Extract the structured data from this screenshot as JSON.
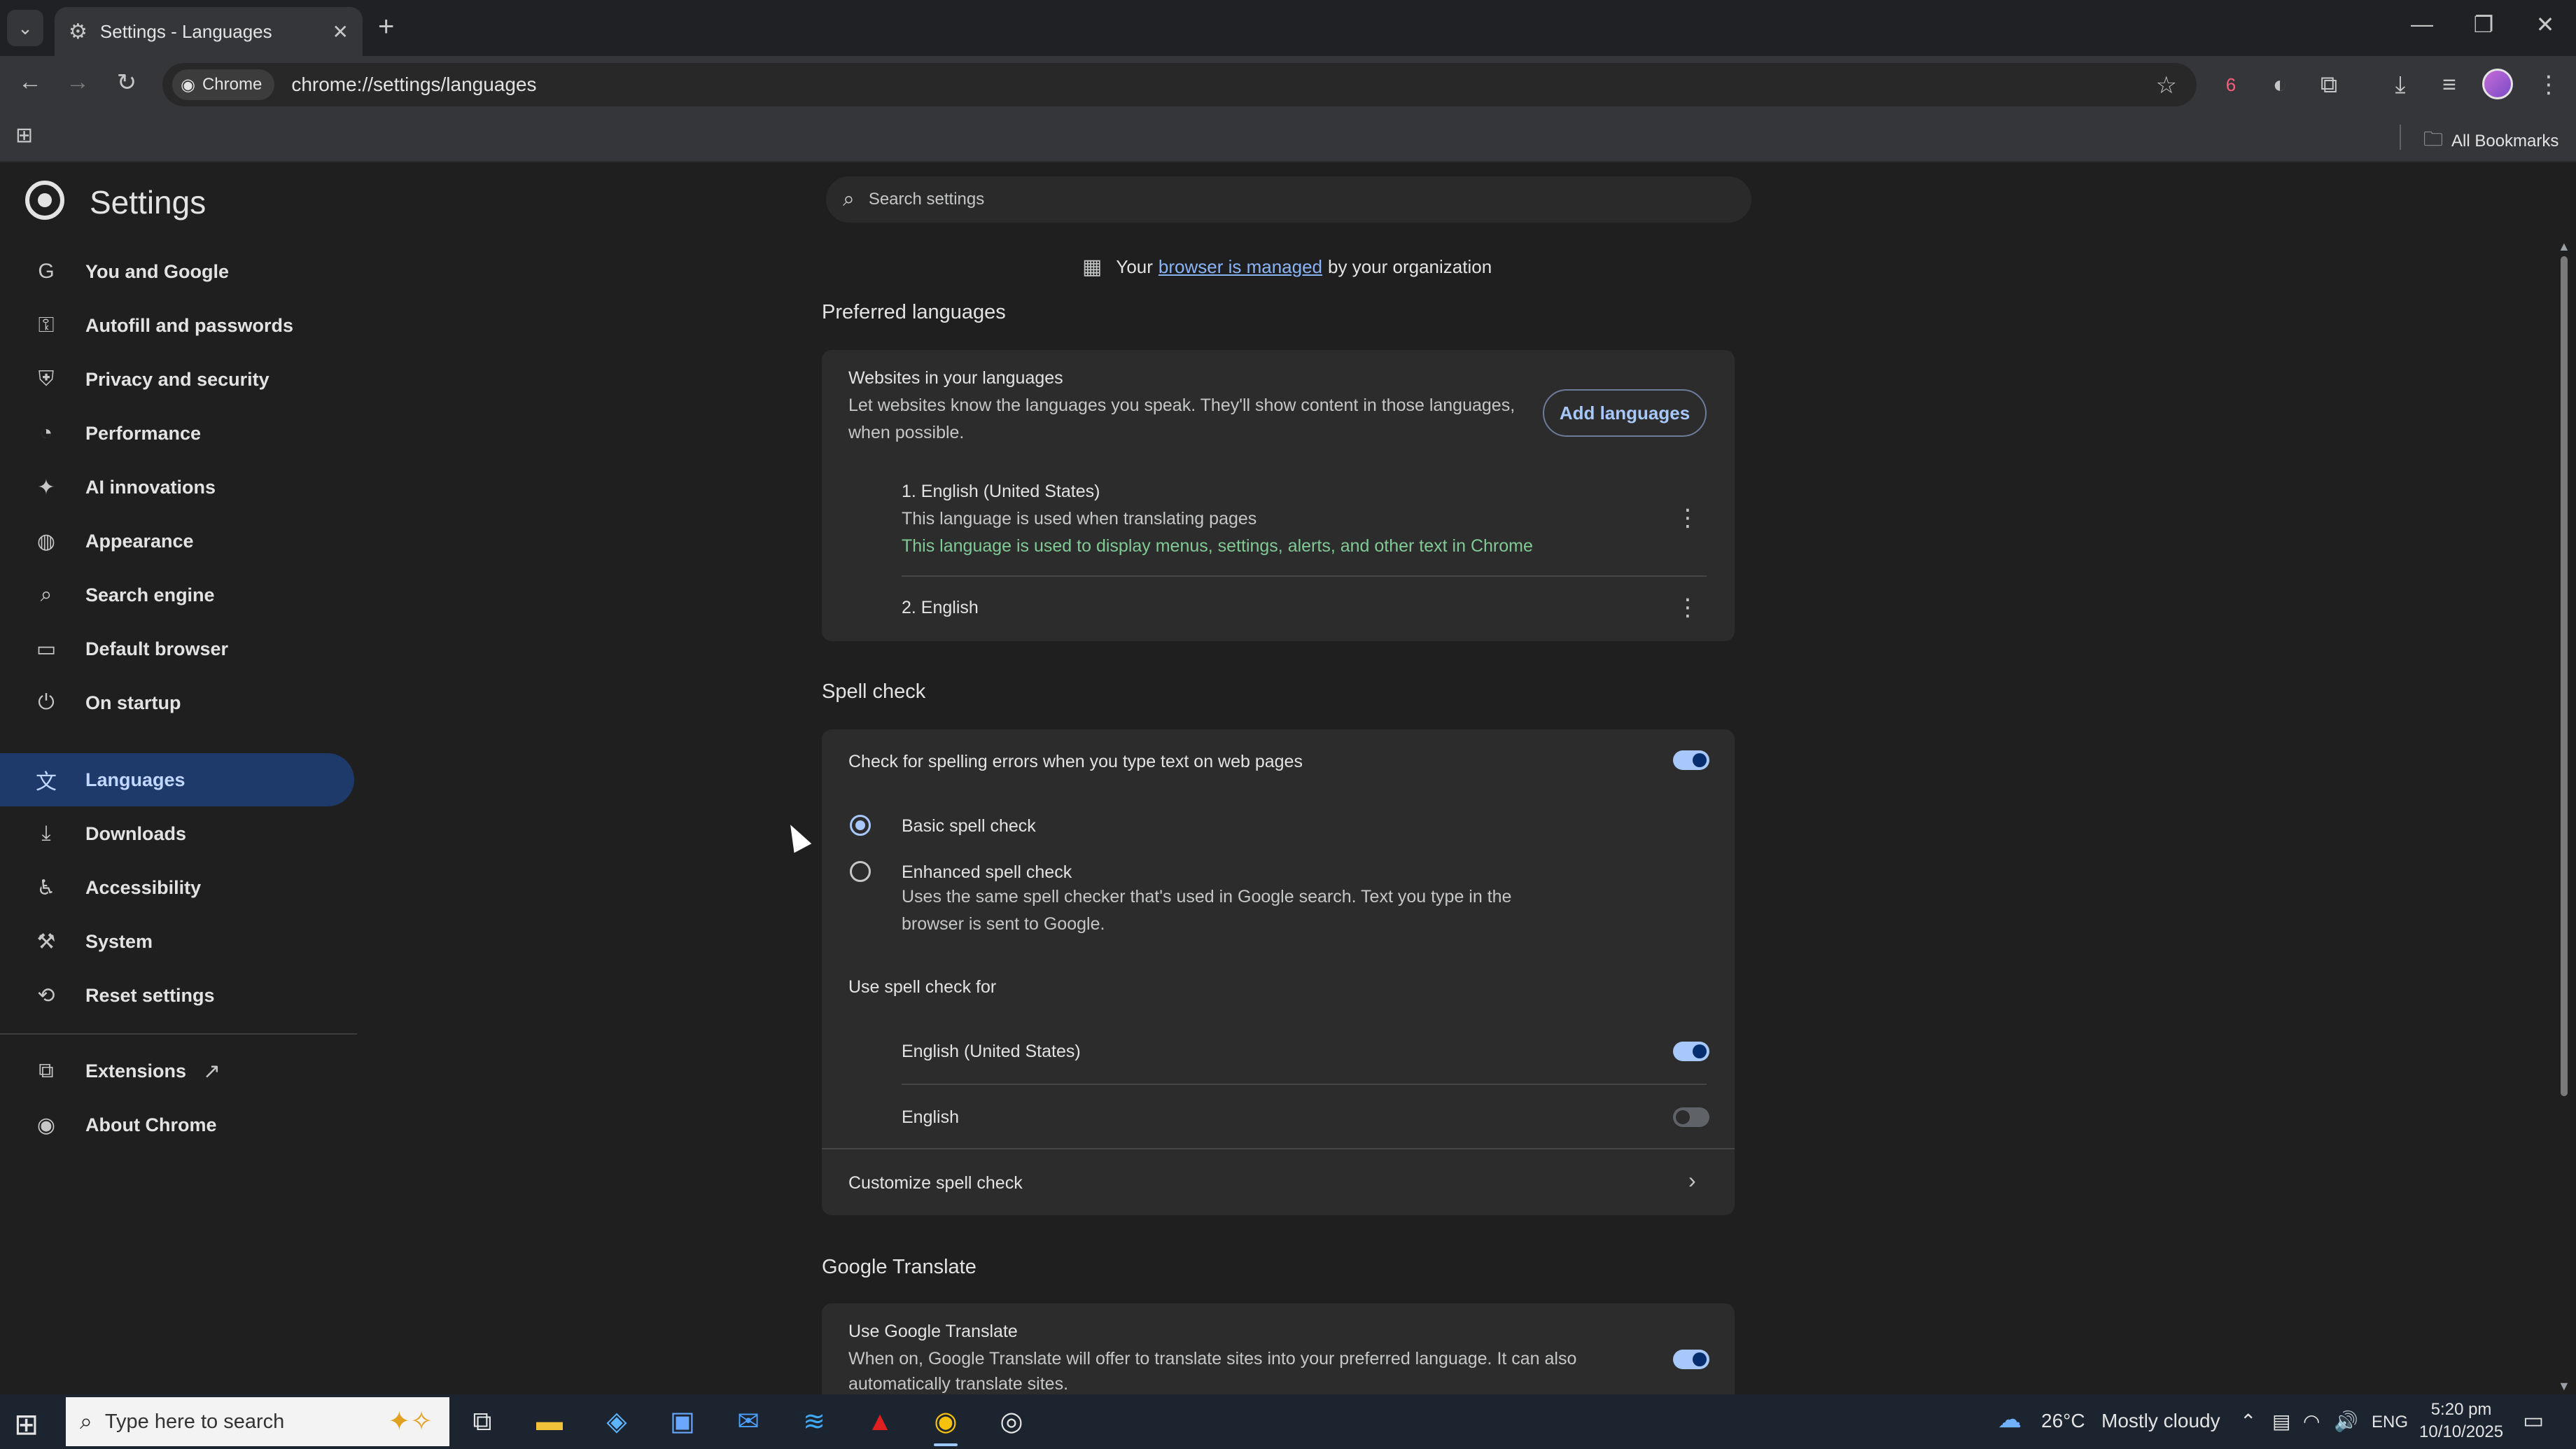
{
  "browser": {
    "tab_title": "Settings - Languages",
    "chip_label": "Chrome",
    "url": "chrome://settings/languages",
    "extension_badge": "6",
    "all_bookmarks": "All Bookmarks"
  },
  "settings": {
    "title": "Settings",
    "search_placeholder": "Search settings"
  },
  "sidebar": {
    "items": [
      {
        "label": "You and Google",
        "icon": "google-g-icon"
      },
      {
        "label": "Autofill and passwords",
        "icon": "key-icon"
      },
      {
        "label": "Privacy and security",
        "icon": "shield-icon"
      },
      {
        "label": "Performance",
        "icon": "speedometer-icon"
      },
      {
        "label": "AI innovations",
        "icon": "sparkle-icon"
      },
      {
        "label": "Appearance",
        "icon": "palette-icon"
      },
      {
        "label": "Search engine",
        "icon": "search-icon"
      },
      {
        "label": "Default browser",
        "icon": "browser-window-icon"
      },
      {
        "label": "On startup",
        "icon": "power-icon"
      },
      {
        "label": "Languages",
        "icon": "translate-icon"
      },
      {
        "label": "Downloads",
        "icon": "download-icon"
      },
      {
        "label": "Accessibility",
        "icon": "accessibility-icon"
      },
      {
        "label": "System",
        "icon": "wrench-icon"
      },
      {
        "label": "Reset settings",
        "icon": "reset-icon"
      },
      {
        "label": "Extensions",
        "icon": "puzzle-icon"
      },
      {
        "label": "About Chrome",
        "icon": "chrome-icon"
      }
    ]
  },
  "managed": {
    "prefix": "Your",
    "link": "browser is managed",
    "suffix": "by your organization"
  },
  "preferred_languages": {
    "section_title": "Preferred languages",
    "websites_title": "Websites in your languages",
    "websites_desc_1": "Let websites know the languages you speak. They'll show content in those languages,",
    "websites_desc_2": "when possible.",
    "add_button": "Add languages",
    "languages": [
      {
        "name": "1. English (United States)",
        "note_1": "This language is used when translating pages",
        "note_2": "This language is used to display menus, settings, alerts, and other text in Chrome"
      },
      {
        "name": "2. English"
      }
    ]
  },
  "spell_check": {
    "section_title": "Spell check",
    "main_toggle_label": "Check for spelling errors when you type text on web pages",
    "main_toggle_on": true,
    "basic_label": "Basic spell check",
    "enhanced_label": "Enhanced spell check",
    "enhanced_desc_1": "Uses the same spell checker that's used in Google search. Text you type in the",
    "enhanced_desc_2": "browser is sent to Google.",
    "use_for_label": "Use spell check for",
    "lang_1": "English (United States)",
    "lang_2": "English",
    "customize": "Customize spell check"
  },
  "google_translate": {
    "section_title": "Google Translate",
    "use_label": "Use Google Translate",
    "desc_1": "When on, Google Translate will offer to translate sites into your preferred language. It can also",
    "desc_2": "automatically translate sites."
  },
  "taskbar": {
    "search_placeholder": "Type here to search",
    "weather_temp": "26°C",
    "weather_desc": "Mostly cloudy",
    "language": "ENG",
    "time": "5:20 pm",
    "date": "10/10/2025"
  },
  "colors": {
    "accent": "#a8c7fa",
    "active_nav_bg": "#1d3a6a",
    "card_bg": "#2c2c2c",
    "page_bg": "#1f1f1f",
    "green_text": "#81c995"
  }
}
